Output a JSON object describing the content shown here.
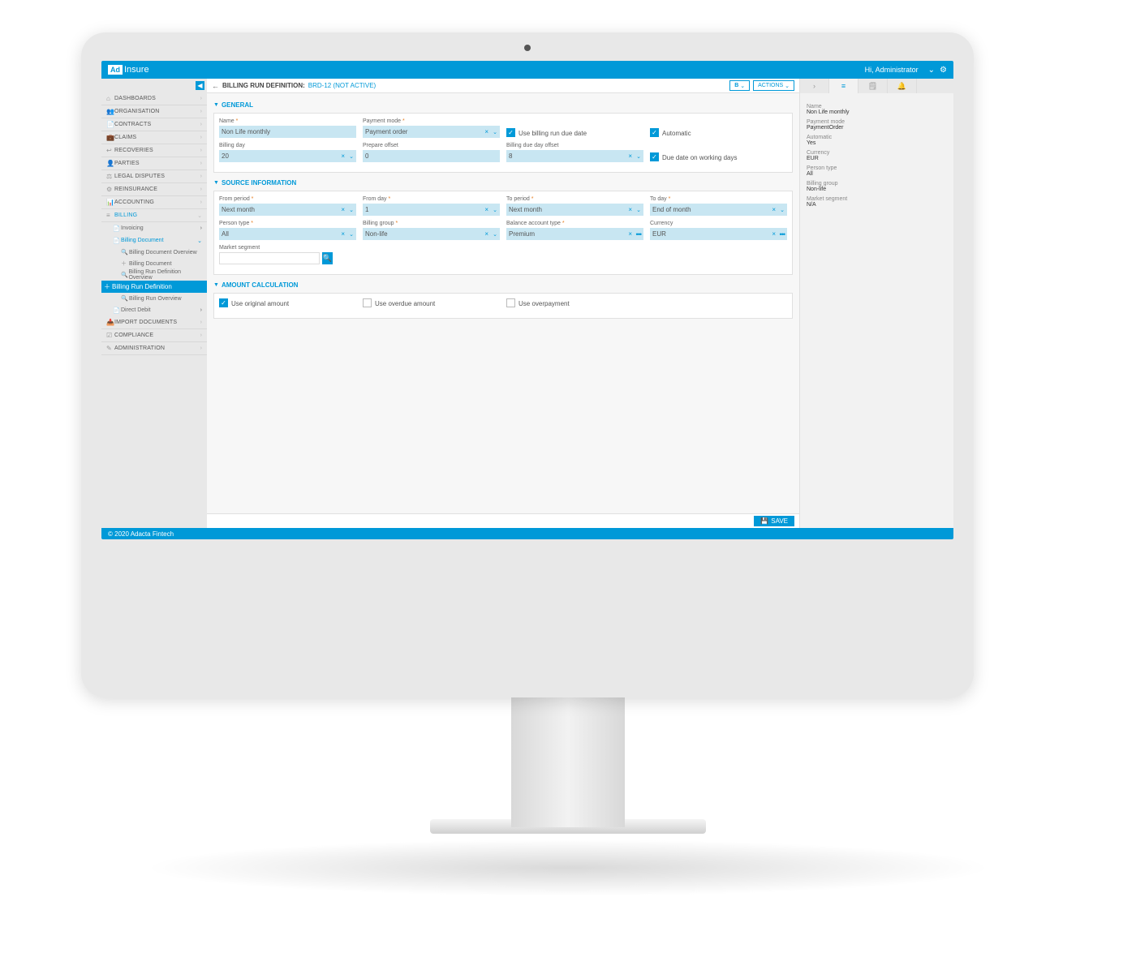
{
  "brand": {
    "box": "Ad",
    "rest": "Insure"
  },
  "topbar": {
    "greeting": "Hi, Administrator"
  },
  "sidebar": {
    "items": [
      {
        "label": "DASHBOARDS",
        "icon": "⌂"
      },
      {
        "label": "ORGANISATION",
        "icon": "👥"
      },
      {
        "label": "CONTRACTS",
        "icon": "📄"
      },
      {
        "label": "CLAIMS",
        "icon": "💼"
      },
      {
        "label": "RECOVERIES",
        "icon": "↩"
      },
      {
        "label": "PARTIES",
        "icon": "👤"
      },
      {
        "label": "LEGAL DISPUTES",
        "icon": "⚖"
      },
      {
        "label": "REINSURANCE",
        "icon": "⚙"
      },
      {
        "label": "ACCOUNTING",
        "icon": "📊"
      },
      {
        "label": "BILLING",
        "icon": "≡"
      }
    ],
    "billing_sub": [
      {
        "label": "Invoicing",
        "icon": "📄"
      },
      {
        "label": "Billing Document",
        "icon": "📄"
      }
    ],
    "billing_doc_sub": [
      {
        "label": "Billing Document Overview",
        "icon": "🔍"
      },
      {
        "label": "Billing Document",
        "icon": "＋"
      },
      {
        "label": "Billing Run Definition Overview",
        "icon": "🔍"
      },
      {
        "label": "Billing Run Definition",
        "icon": "＋"
      },
      {
        "label": "Billing Run Overview",
        "icon": "🔍"
      }
    ],
    "billing_sub2": {
      "label": "Direct Debit",
      "icon": "📄"
    },
    "rest": [
      {
        "label": "IMPORT DOCUMENTS",
        "icon": "📥"
      },
      {
        "label": "COMPLIANCE",
        "icon": "☑"
      },
      {
        "label": "ADMINISTRATION",
        "icon": "✎"
      }
    ]
  },
  "crumb": {
    "title": "BILLING RUN DEFINITION:",
    "id": "BRD-12 (NOT ACTIVE)",
    "b_btn": "B",
    "actions_btn": "ACTIONS"
  },
  "sections": {
    "general": "GENERAL",
    "source": "SOURCE INFORMATION",
    "amount": "AMOUNT CALCULATION"
  },
  "general": {
    "name_lbl": "Name",
    "name_val": "Non Life monthly",
    "paymode_lbl": "Payment mode",
    "paymode_val": "Payment order",
    "use_due_lbl": "Use billing run due date",
    "automatic_lbl": "Automatic",
    "billday_lbl": "Billing day",
    "billday_val": "20",
    "prep_lbl": "Prepare offset",
    "prep_val": "0",
    "dueoff_lbl": "Billing due day offset",
    "dueoff_val": "8",
    "working_lbl": "Due date on working days"
  },
  "source": {
    "from_period_lbl": "From period",
    "from_period_val": "Next month",
    "from_day_lbl": "From day",
    "from_day_val": "1",
    "to_period_lbl": "To period",
    "to_period_val": "Next month",
    "to_day_lbl": "To day",
    "to_day_val": "End of month",
    "ptype_lbl": "Person type",
    "ptype_val": "All",
    "bgroup_lbl": "Billing group",
    "bgroup_val": "Non-life",
    "bact_lbl": "Balance account type",
    "bact_val": "Premium",
    "curr_lbl": "Currency",
    "curr_val": "EUR",
    "mseg_lbl": "Market segment",
    "mseg_val": ""
  },
  "amount": {
    "orig": "Use original amount",
    "overdue": "Use overdue amount",
    "overpay": "Use overpayment"
  },
  "rpanel": {
    "name_k": "Name",
    "name_v": "Non Life monthly",
    "pm_k": "Payment mode",
    "pm_v": "PaymentOrder",
    "auto_k": "Automatic",
    "auto_v": "Yes",
    "curr_k": "Currency",
    "curr_v": "EUR",
    "pt_k": "Person type",
    "pt_v": "All",
    "bg_k": "Billing group",
    "bg_v": "Non-life",
    "ms_k": "Market segment",
    "ms_v": "N/A"
  },
  "save_btn": "SAVE",
  "footer": "© 2020 Adacta Fintech"
}
